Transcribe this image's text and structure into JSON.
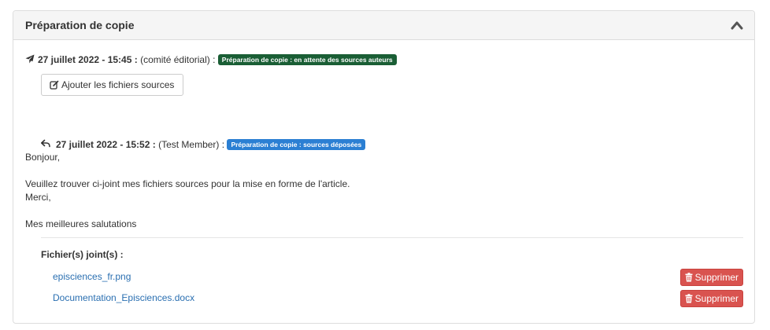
{
  "panel": {
    "title": "Préparation de copie"
  },
  "entry1": {
    "date": "27 juillet 2022 - 15:45 :",
    "author": "(comité éditorial) :",
    "badge": "Préparation de copie : en attente des sources auteurs",
    "badge_color": "#1a5e35",
    "icon": "paper-plane-icon",
    "button_label": "Ajouter les fichiers sources",
    "button_icon": "edit-icon"
  },
  "entry2": {
    "date": "27 juillet 2022 - 15:52 :",
    "author": "(Test Member) :",
    "badge": "Préparation de copie : sources déposées",
    "badge_color": "#2b7fd3",
    "icon": "reply-icon",
    "message": {
      "line1": "Bonjour,",
      "line2": "Veuillez trouver ci-joint mes fichiers sources pour la mise en forme de l'article.",
      "line3": "Merci,",
      "line4": "Mes meilleures salutations"
    }
  },
  "attachments": {
    "title": "Fichier(s) joint(s) :",
    "delete_label": "Supprimer",
    "delete_icon": "trash-icon",
    "files": [
      {
        "name": "episciences_fr.png"
      },
      {
        "name": "Documentation_Episciences.docx"
      }
    ]
  },
  "colors": {
    "link": "#2a6fb1",
    "danger": "#d9534f",
    "heading_bg": "#f5f5f5"
  }
}
